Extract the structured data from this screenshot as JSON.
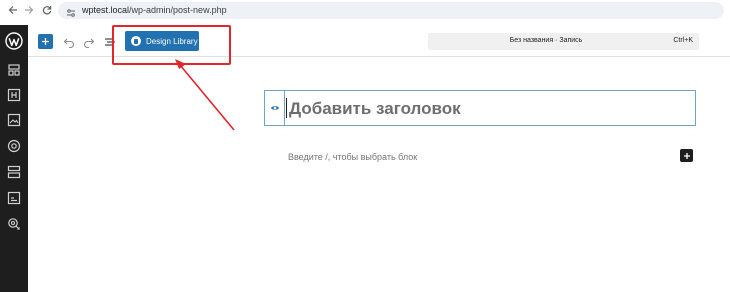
{
  "browser": {
    "url_host": "wptest.local",
    "url_path": "/wp-admin/post-new.php"
  },
  "sidebar": {
    "items": [
      {
        "icon": "wordpress-logo-icon"
      },
      {
        "icon": "patterns-icon"
      },
      {
        "icon": "heading-icon"
      },
      {
        "icon": "image-icon"
      },
      {
        "icon": "target-icon"
      },
      {
        "icon": "layout-icon"
      },
      {
        "icon": "gallery-icon"
      },
      {
        "icon": "settings-icon"
      }
    ]
  },
  "toolbar": {
    "design_library_label": "Design Library",
    "command_title": "Без названия · Запись",
    "command_shortcut": "Ctrl+K"
  },
  "editor": {
    "title_placeholder": "Добавить заголовок",
    "paragraph_placeholder": "Введите /, чтобы выбрать блок"
  },
  "colors": {
    "accent": "#2271b1",
    "sidebar_bg": "#1e1e1e",
    "annotation": "#e3262c"
  }
}
